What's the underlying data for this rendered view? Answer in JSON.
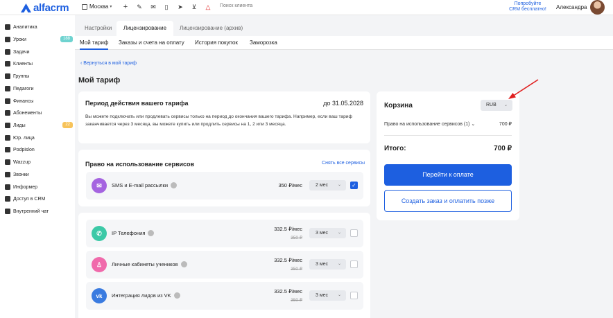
{
  "topbar": {
    "logo": "alfacrm",
    "city": "Москва",
    "search_placeholder": "Поиск клиента",
    "promo_line1": "Попробуйте",
    "promo_line2": "CRM бесплатно!",
    "user_name": "Александра"
  },
  "sidebar": {
    "items": [
      {
        "label": "Аналитика",
        "icon": "chart-icon"
      },
      {
        "label": "Уроки",
        "icon": "book-icon",
        "badge": "188",
        "badge_color": "#6fd3d0"
      },
      {
        "label": "Задачи",
        "icon": "clipboard-icon"
      },
      {
        "label": "Клиенты",
        "icon": "user-icon"
      },
      {
        "label": "Группы",
        "icon": "users-icon"
      },
      {
        "label": "Педагоги",
        "icon": "teacher-icon"
      },
      {
        "label": "Финансы",
        "icon": "wallet-icon"
      },
      {
        "label": "Абонементы",
        "icon": "ticket-icon"
      },
      {
        "label": "Лиды",
        "icon": "funnel-icon",
        "badge": "22",
        "badge_color": "#f7c35a"
      },
      {
        "label": "Юр. лица",
        "icon": "building-icon"
      },
      {
        "label": "Podpislon",
        "icon": "signature-icon"
      },
      {
        "label": "Wazzup",
        "icon": "chat-icon"
      },
      {
        "label": "Звонки",
        "icon": "phone-icon"
      },
      {
        "label": "Информер",
        "icon": "bell-icon"
      },
      {
        "label": "Доступ в CRM",
        "icon": "lock-icon"
      },
      {
        "label": "Внутренний чат",
        "icon": "message-icon"
      }
    ]
  },
  "tabs": {
    "top": [
      "Настройки",
      "Лицензирование",
      "Лицензирование (архив)"
    ],
    "sub": [
      "Мой тариф",
      "Заказы и счета на оплату",
      "История покупок",
      "Заморозка"
    ]
  },
  "main": {
    "back_link": "Вернуться в мой тариф",
    "title": "Мой тариф",
    "period": {
      "title": "Период действия вашего тарифа",
      "date": "до 31.05.2028",
      "text": "Вы можете подключать или продлевать сервисы только на период до окончания вашего тарифа. Например, если ваш тариф заканчивается через 3 месяца, вы можете купить или продлить сервисы на 1, 2 или 3 месяца."
    },
    "services": {
      "title": "Право на использование сервисов",
      "unselect_all": "Снять все сервисы",
      "items": [
        {
          "name": "SMS и E-mail рассылки",
          "price": "350 ₽/мес",
          "old_price": "",
          "period": "2 мес",
          "checked": true,
          "color": "#a564e0",
          "icon": "sms-icon"
        },
        {
          "name": "IP Телефония",
          "price": "332.5 ₽/мес",
          "old_price": "350 ₽",
          "period": "3 мес",
          "checked": false,
          "color": "#3cc9a7",
          "icon": "phone-icon"
        },
        {
          "name": "Личные кабинеты учеников",
          "price": "332.5 ₽/мес",
          "old_price": "350 ₽",
          "period": "3 мес",
          "checked": false,
          "color": "#f06aab",
          "icon": "student-icon"
        },
        {
          "name": "Интеграция лидов из VK",
          "price": "332.5 ₽/мес",
          "old_price": "350 ₽",
          "period": "3 мес",
          "checked": false,
          "color": "#3a7be0",
          "icon": "vk-icon"
        }
      ]
    }
  },
  "cart": {
    "title": "Корзина",
    "currency": "RUB",
    "line_label": "Право на использование сервисов (1)",
    "line_value": "700 ₽",
    "total_label": "Итого:",
    "total_value": "700 ₽",
    "pay_button": "Перейти к оплате",
    "order_button": "Создать заказ и оплатить позже"
  },
  "colors": {
    "accent": "#1d5fe0",
    "annotation_arrow": "#e02020"
  }
}
